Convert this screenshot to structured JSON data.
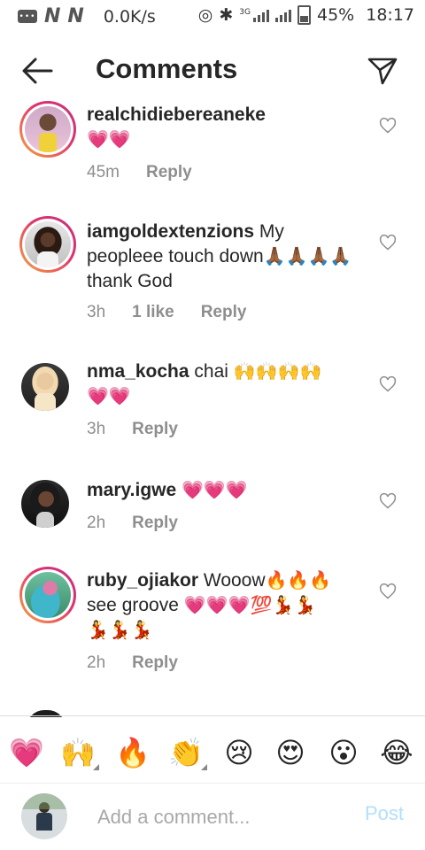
{
  "status_bar": {
    "speed": "0.0K/s",
    "battery": "45%",
    "time": "18:17",
    "network": "3G"
  },
  "header": {
    "title": "Comments"
  },
  "comments": [
    {
      "username": "realchidiebereaneke",
      "text": "",
      "emoji": "💗💗",
      "time": "45m",
      "likes": "",
      "reply": "Reply"
    },
    {
      "username": "iamgoldextenzions",
      "text": " My peopleee touch down",
      "emoji": "🙏🏾🙏🏾🙏🏾🙏🏾",
      "text2": " thank God",
      "time": "3h",
      "likes": "1 like",
      "reply": "Reply"
    },
    {
      "username": "nma_kocha",
      "text": " chai ",
      "emoji": "🙌🙌🙌🙌",
      "emoji2": "💗💗",
      "time": "3h",
      "likes": "",
      "reply": "Reply"
    },
    {
      "username": "mary.igwe",
      "text": " ",
      "emoji": "💗💗💗",
      "time": "2h",
      "likes": "",
      "reply": "Reply"
    },
    {
      "username": "ruby_ojiakor",
      "text": " Wooow",
      "emoji": "🔥🔥🔥",
      "text2": " see groove ",
      "emoji2": "💗💗💗💯💃💃",
      "emoji3": "💃💃💃",
      "time": "2h",
      "likes": "",
      "reply": "Reply"
    }
  ],
  "emoji_bar": [
    "💗",
    "🙌",
    "🔥",
    "👏",
    "😢",
    "😍",
    "😮",
    "😂"
  ],
  "composer": {
    "placeholder": "Add a comment...",
    "post_label": "Post"
  },
  "colors": {
    "accent_post": "#b2dffc",
    "story_ring_start": "#f7a440",
    "story_ring_end": "#c13584",
    "muted_text": "#8e8e8e"
  }
}
